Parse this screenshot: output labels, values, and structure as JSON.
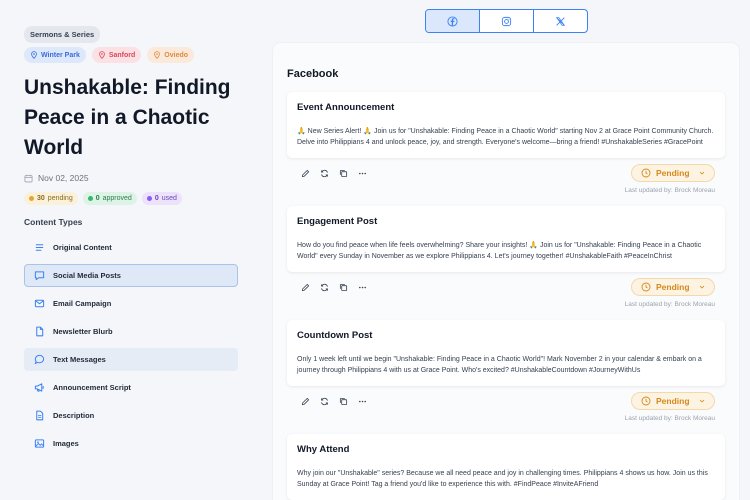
{
  "sidebar": {
    "series_label": "Sermons & Series",
    "locations": [
      "Winter Park",
      "Sanford",
      "Oviedo"
    ],
    "title": "Unshakable: Finding Peace in a Chaotic World",
    "date": "Nov 02, 2025",
    "stats": {
      "pending_count": "30",
      "pending_label": "pending",
      "approved_count": "0",
      "approved_label": "approved",
      "used_count": "0",
      "used_label": "used"
    },
    "content_types_heading": "Content Types",
    "items": [
      {
        "label": "Original Content",
        "icon": "lines-icon"
      },
      {
        "label": "Social Media Posts",
        "icon": "chat-square-icon"
      },
      {
        "label": "Email Campaign",
        "icon": "mail-icon"
      },
      {
        "label": "Newsletter Blurb",
        "icon": "file-icon"
      },
      {
        "label": "Text Messages",
        "icon": "chat-bubble-icon"
      },
      {
        "label": "Announcement Script",
        "icon": "megaphone-icon"
      },
      {
        "label": "Description",
        "icon": "doc-text-icon"
      },
      {
        "label": "Images",
        "icon": "image-icon"
      }
    ]
  },
  "platforms": [
    "facebook",
    "instagram",
    "x"
  ],
  "panel": {
    "title": "Facebook",
    "posts": [
      {
        "title": "Event Announcement",
        "body": "🙏 New Series Alert! 🙏 Join us for \"Unshakable: Finding Peace in a Chaotic World\" starting Nov 2 at Grace Point Community Church. Delve into Philippians 4 and unlock peace, joy, and strength. Everyone's welcome—bring a friend! #UnshakableSeries #GracePoint",
        "status": "Pending",
        "updated": "Last updated by: Brock Moreau"
      },
      {
        "title": "Engagement Post",
        "body": "How do you find peace when life feels overwhelming? Share your insights! 🙏 Join us for \"Unshakable: Finding Peace in a Chaotic World\" every Sunday in November as we explore Philippians 4. Let's journey together! #UnshakableFaith #PeaceInChrist",
        "status": "Pending",
        "updated": "Last updated by: Brock Moreau"
      },
      {
        "title": "Countdown Post",
        "body": "Only 1 week left until we begin \"Unshakable: Finding Peace in a Chaotic World\"! Mark November 2 in your calendar & embark on a journey through Philippians 4 with us at Grace Point. Who's excited? #UnshakableCountdown #JourneyWithUs",
        "status": "Pending",
        "updated": "Last updated by: Brock Moreau"
      },
      {
        "title": "Why Attend",
        "body": "Why join our \"Unshakable\" series? Because we all need peace and joy in challenging times. Philippians 4 shows us how. Join us this Sunday at Grace Point! Tag a friend you'd like to experience this with. #FindPeace #InviteAFriend",
        "status": "",
        "updated": ""
      }
    ]
  },
  "colors": {
    "accent": "#3b82f6",
    "pending": "#d48a1a"
  }
}
